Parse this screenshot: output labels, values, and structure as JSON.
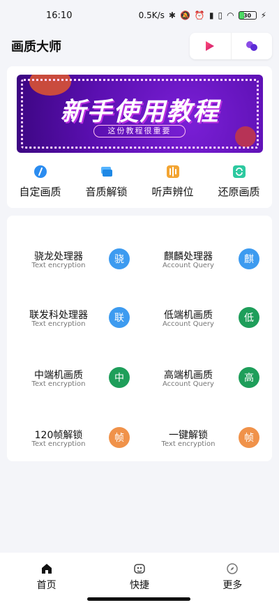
{
  "status_bar": {
    "time": "16:10",
    "speed": "0.5K/s",
    "battery": "30"
  },
  "header": {
    "title": "画质大师",
    "icons": [
      "play-icon",
      "dots-icon"
    ]
  },
  "banner": {
    "title": "新手使用教程",
    "subtitle": "这份教程很重要"
  },
  "quick_actions": [
    {
      "label": "自定画质",
      "icon": "pen-icon",
      "color": "#2b8cf0"
    },
    {
      "label": "音质解锁",
      "icon": "layers-icon",
      "color": "#2b9cf0"
    },
    {
      "label": "听声辨位",
      "icon": "audio-icon",
      "color": "#f3a533"
    },
    {
      "label": "还原画质",
      "icon": "refresh-icon",
      "color": "#2dc9a0"
    }
  ],
  "grid": [
    {
      "title": "骁龙处理器",
      "sub": "Text encryption",
      "badge": "骁",
      "color": "#3d9bf0"
    },
    {
      "title": "麒麟处理器",
      "sub": "Account Query",
      "badge": "麒",
      "color": "#3d9bf0"
    },
    {
      "title": "联发科处理器",
      "sub": "Text encryption",
      "badge": "联",
      "color": "#3d9bf0"
    },
    {
      "title": "低端机画质",
      "sub": "Account Query",
      "badge": "低",
      "color": "#1e9e5a"
    },
    {
      "title": "中端机画质",
      "sub": "Text encryption",
      "badge": "中",
      "color": "#1e9e5a"
    },
    {
      "title": "高端机画质",
      "sub": "Account Query",
      "badge": "高",
      "color": "#1e9e5a"
    },
    {
      "title": "120帧解锁",
      "sub": "Text encryption",
      "badge": "帧",
      "color": "#f0924a"
    },
    {
      "title": "一键解锁",
      "sub": "Text encryption",
      "badge": "帧",
      "color": "#f0924a"
    }
  ],
  "nav": [
    {
      "label": "首页",
      "icon": "home-icon"
    },
    {
      "label": "快捷",
      "icon": "gamepad-icon"
    },
    {
      "label": "更多",
      "icon": "compass-icon"
    }
  ]
}
